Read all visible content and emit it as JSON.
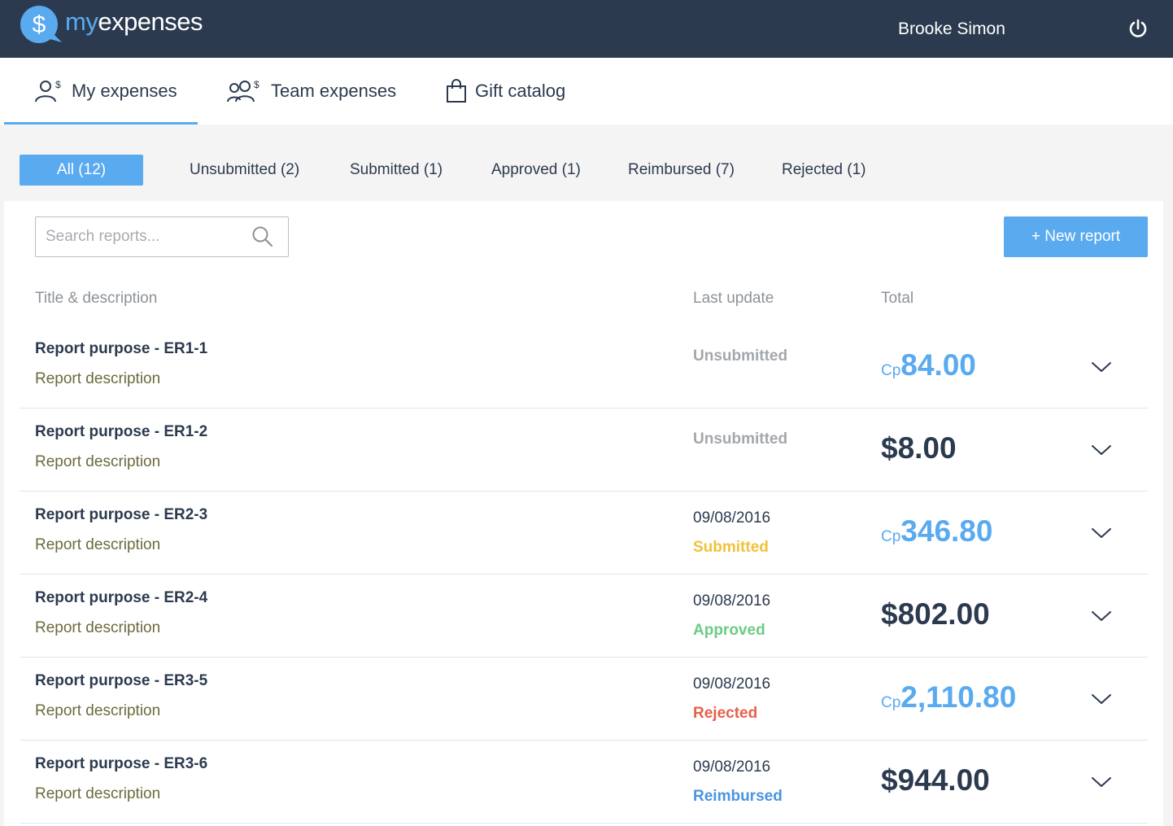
{
  "app": {
    "logo_word_1": "my",
    "logo_word_2": "expenses",
    "logo_symbol": "$",
    "user_name": "Brooke Simon"
  },
  "nav": {
    "tabs": [
      {
        "label": "My expenses",
        "icon": "user-dollar-icon",
        "active": true
      },
      {
        "label": "Team expenses",
        "icon": "team-dollar-icon",
        "active": false
      },
      {
        "label": "Gift catalog",
        "icon": "shopping-bag-icon",
        "active": false
      }
    ]
  },
  "filters": [
    {
      "label": "All (12)",
      "active": true
    },
    {
      "label": "Unsubmitted (2)",
      "active": false
    },
    {
      "label": "Submitted (1)",
      "active": false
    },
    {
      "label": "Approved (1)",
      "active": false
    },
    {
      "label": "Reimbursed (7)",
      "active": false
    },
    {
      "label": "Rejected (1)",
      "active": false
    }
  ],
  "search": {
    "placeholder": "Search reports...",
    "value": ""
  },
  "new_report_label": "+ New report",
  "columns": {
    "title": "Title & description",
    "last_update": "Last update",
    "total": "Total"
  },
  "colors": {
    "accent": "#5aaaf0",
    "header_bg": "#2c3a4f",
    "unsubmitted": "#a3a7ab",
    "submitted": "#f0c23a",
    "approved": "#6ccb86",
    "rejected": "#e7604a",
    "reimbursed": "#4a94e0"
  },
  "reports": [
    {
      "title": "Report purpose - ER1-1",
      "description": "Report description",
      "date": "",
      "status": "Unsubmitted",
      "status_key": "unsubmitted",
      "currency": "Cp",
      "amount": "84.00",
      "highlight": true
    },
    {
      "title": "Report purpose - ER1-2",
      "description": "Report description",
      "date": "",
      "status": "Unsubmitted",
      "status_key": "unsubmitted",
      "currency": "",
      "amount": "$8.00",
      "highlight": false
    },
    {
      "title": "Report purpose - ER2-3",
      "description": "Report description",
      "date": "09/08/2016",
      "status": "Submitted",
      "status_key": "submitted",
      "currency": "Cp",
      "amount": "346.80",
      "highlight": true
    },
    {
      "title": "Report purpose - ER2-4",
      "description": "Report description",
      "date": "09/08/2016",
      "status": "Approved",
      "status_key": "approved",
      "currency": "",
      "amount": "$802.00",
      "highlight": false
    },
    {
      "title": "Report purpose - ER3-5",
      "description": "Report description",
      "date": "09/08/2016",
      "status": "Rejected",
      "status_key": "rejected",
      "currency": "Cp",
      "amount": "2,110.80",
      "highlight": true
    },
    {
      "title": "Report purpose - ER3-6",
      "description": "Report description",
      "date": "09/08/2016",
      "status": "Reimbursed",
      "status_key": "reimbursed",
      "currency": "",
      "amount": "$944.00",
      "highlight": false
    }
  ]
}
